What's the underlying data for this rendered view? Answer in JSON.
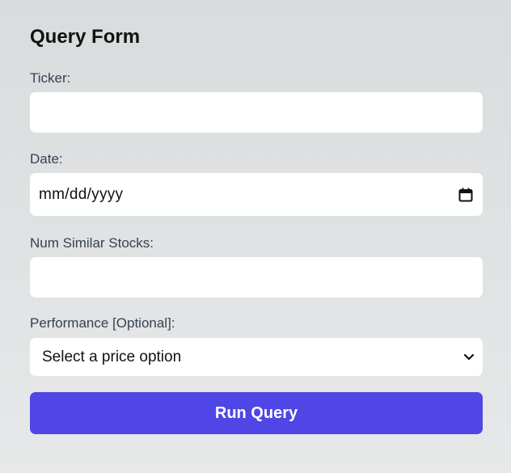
{
  "form": {
    "title": "Query Form",
    "ticker": {
      "label": "Ticker:",
      "value": ""
    },
    "date": {
      "label": "Date:",
      "value": "mm/dd/yyyy",
      "icon": "calendar-icon"
    },
    "num_similar": {
      "label": "Num Similar Stocks:",
      "value": ""
    },
    "performance": {
      "label": "Performance [Optional]:",
      "selected": "Select a price option",
      "icon": "chevron-down-icon"
    },
    "submit_label": "Run Query",
    "accent_color": "#4f46e5"
  }
}
